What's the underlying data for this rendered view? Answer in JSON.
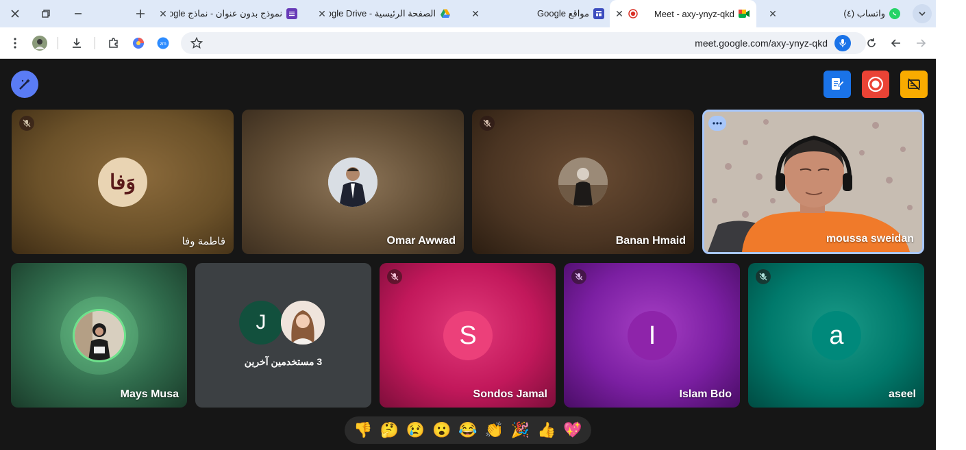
{
  "browser": {
    "tabs": [
      {
        "title": "واتساب (٤)",
        "favicon": "whatsapp-icon",
        "color": "#25d366"
      },
      {
        "title": "Meet - axy-ynyz-qkd",
        "favicon": "meet-recording-icon",
        "color": "#d93025",
        "active": true
      },
      {
        "title": "مواقع Google",
        "favicon": "google-sites-icon",
        "color": "#3c4dbf"
      },
      {
        "title": "الصفحة الرئيسية - Google Drive",
        "favicon": "google-drive-icon",
        "color": "#1fa463"
      },
      {
        "title": "نموذج بدون عنوان - نماذج Google",
        "favicon": "google-forms-icon",
        "color": "#673ab7"
      }
    ],
    "url": "meet.google.com/axy-ynyz-qkd"
  },
  "meet": {
    "colors": {
      "accent_blue": "#1a73e8",
      "record_red": "#ea4335",
      "yellow": "#f9ab00"
    },
    "top_row": [
      {
        "name": "قاطمة وفا",
        "muted": true,
        "avatar_text": "وَفا",
        "bg": "#6b5129"
      },
      {
        "name": "Omar Awwad",
        "muted": false,
        "bg": "#5e4a32"
      },
      {
        "name": "Banan Hmaid",
        "muted": true,
        "bg": "#4a3422"
      },
      {
        "name": "moussa sweidan",
        "muted": false,
        "speaking": true,
        "bg": "#a59786"
      }
    ],
    "bottom_row": [
      {
        "name": "Mays Musa",
        "muted": false,
        "bg": "#2f6a4b"
      },
      {
        "name": "",
        "muted": false,
        "group_label": "3 مستخدمين آخرين",
        "letter": "J",
        "bg": "#3c4043"
      },
      {
        "name": "Sondos Jamal",
        "muted": true,
        "letter": "S",
        "bg": "#c2185b"
      },
      {
        "name": "Islam Bdo",
        "muted": true,
        "letter": "I",
        "bg": "#7b1fa2"
      },
      {
        "name": "aseel",
        "muted": true,
        "letter": "a",
        "bg": "#00796b"
      }
    ],
    "reactions": [
      "👎",
      "🤔",
      "😢",
      "😮",
      "😂",
      "👏",
      "🎉",
      "👍",
      "💖"
    ]
  }
}
